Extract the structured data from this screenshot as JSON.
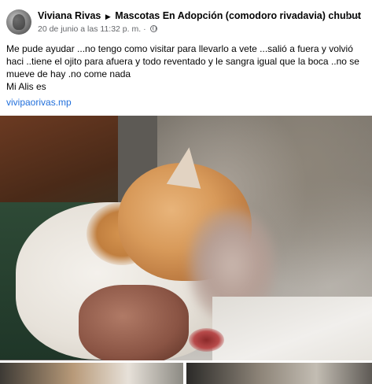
{
  "post": {
    "author": "Viviana Rivas",
    "group": "Mascotas En Adopción (comodoro rivadavia) chubut",
    "timestamp": "20 de junio a las 11:32 p. m.",
    "separator": "·",
    "visibility_icon": "globe-icon",
    "more_icon": "more-options-icon",
    "more_label": "···",
    "body_line_1": "Me pude ayudar ...no tengo como visitar para llevarlo a vete ...salió a fuera y volvió haci ..tiene el ojito para afuera y todo reventado y le sangra igual que la boca ..no se mueve de hay .no come nada",
    "body_line_2": "Mi Alis es",
    "link_text": "vivipaorivas.mp"
  },
  "media": {
    "main_photo_alt": "cat photo",
    "thumbnail_count": 2
  },
  "colors": {
    "link": "#216fdb",
    "meta": "#65676b",
    "text": "#050505"
  }
}
